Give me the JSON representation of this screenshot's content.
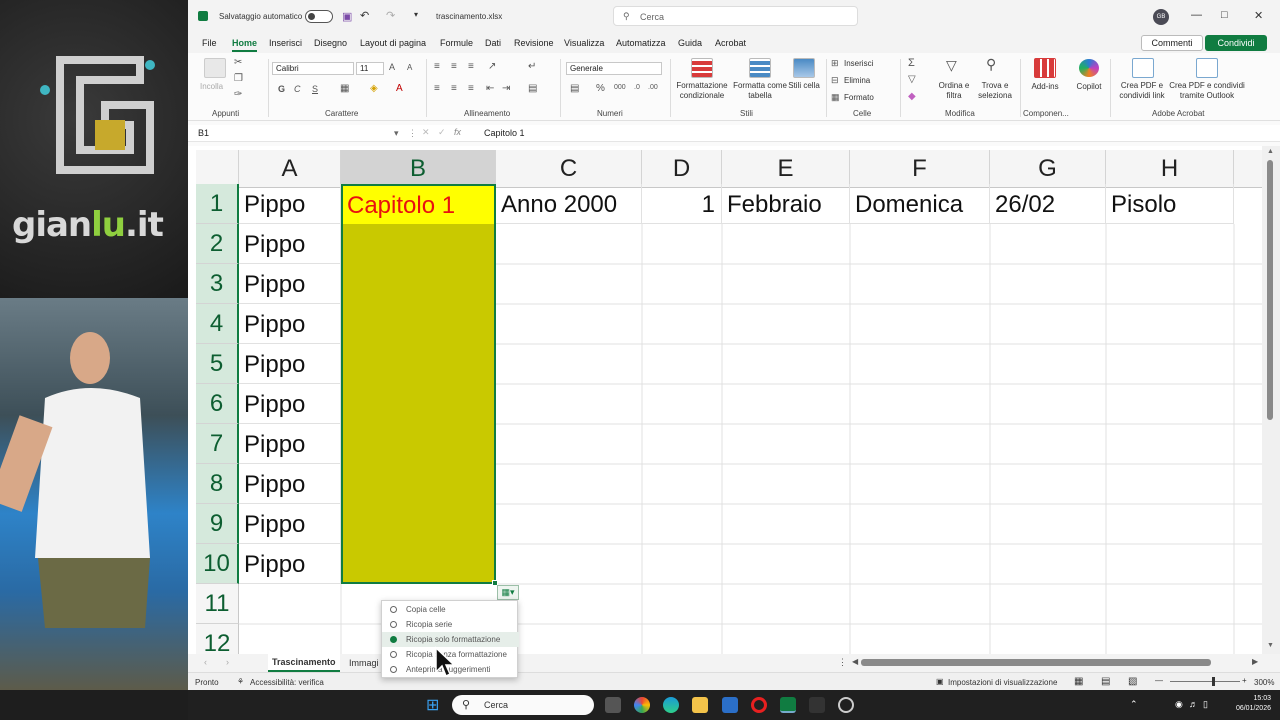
{
  "titlebar": {
    "autosave": "Salvataggio automatico",
    "filename": "trascinamento.xlsx",
    "search": "Cerca",
    "avatar": "GB"
  },
  "menu": {
    "items": [
      "File",
      "Home",
      "Inserisci",
      "Disegno",
      "Layout di pagina",
      "Formule",
      "Dati",
      "Revisione",
      "Visualizza",
      "Automatizza",
      "Guida",
      "Acrobat"
    ],
    "comments": "Commenti",
    "share": "Condividi"
  },
  "ribbon": {
    "paste": "Incolla",
    "font_name": "Calibri",
    "font_size": "11",
    "number_format": "Generale",
    "groups": {
      "clipboard": "Appunti",
      "font": "Carattere",
      "alignment": "Allineamento",
      "number": "Numeri",
      "styles": "Stili",
      "cells": "Celle",
      "edit": "Modifica",
      "components": "Componen...",
      "acrobat": "Adobe Acrobat"
    },
    "cond_format": "Formattazione condizionale",
    "format_table": "Formatta come tabella",
    "cell_styles": "Stili cella",
    "insert": "Inserisci",
    "delete": "Elimina",
    "format": "Formato",
    "sort": "Ordina e filtra",
    "find": "Trova e seleziona",
    "addins": "Add-ins",
    "copilot": "Copilot",
    "pdf_link": "Crea PDF e condividi link",
    "pdf_outlook": "Crea PDF e condividi tramite Outlook",
    "bold": "G",
    "italic": "C",
    "underline": "S",
    "grow": "A",
    "shrink": "A"
  },
  "formula": {
    "namebox": "B1",
    "value": "Capitolo 1",
    "fx": "fx"
  },
  "grid": {
    "columns": [
      "A",
      "B",
      "C",
      "D",
      "E",
      "F",
      "G",
      "H"
    ],
    "rows": [
      "1",
      "2",
      "3",
      "4",
      "5",
      "6",
      "7",
      "8",
      "9",
      "10",
      "11",
      "12"
    ],
    "row1": {
      "A": "Pippo",
      "B": "Capitolo 1",
      "C": "Anno 2000",
      "D": "1",
      "E": "Febbraio",
      "F": "Domenica",
      "G": "26/02",
      "H": "Pisolo"
    },
    "colA": [
      "Pippo",
      "Pippo",
      "Pippo",
      "Pippo",
      "Pippo",
      "Pippo",
      "Pippo",
      "Pippo",
      "Pippo"
    ]
  },
  "autofill_options": [
    "Copia celle",
    "Ricopia serie",
    "Ricopia solo formattazione",
    "Ricopia senza formattazione",
    "Anteprima suggerimenti"
  ],
  "tabs": {
    "active": "Trascinamento",
    "second": "Immagi"
  },
  "status": {
    "ready": "Pronto",
    "accessibility": "Accessibilità: verifica",
    "display": "Impostazioni di visualizzazione",
    "zoom": "300%"
  },
  "taskbar": {
    "search": "Cerca",
    "time": "15:03",
    "date": "06/01/2026"
  },
  "logo": {
    "prefix": "gian",
    "accent": "lu",
    "suffix": ".it"
  },
  "colors": {
    "accent": "#107c41",
    "selection_fill": "#c9c900",
    "b1_fill": "#ffff00",
    "b1_text": "#e81010"
  }
}
